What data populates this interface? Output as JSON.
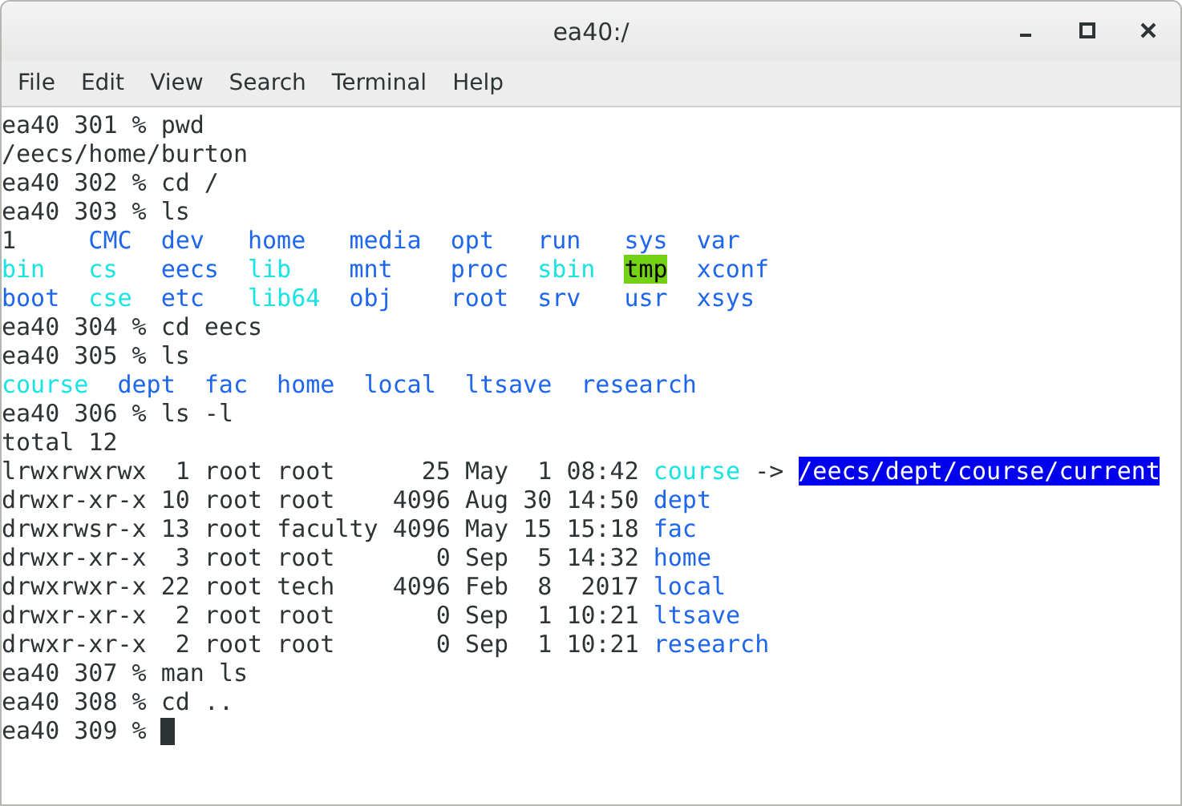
{
  "window": {
    "title": "ea40:/"
  },
  "menu": [
    "File",
    "Edit",
    "View",
    "Search",
    "Terminal",
    "Help"
  ],
  "terminal": [
    {
      "kind": "text",
      "text": "ea40 301 % pwd"
    },
    {
      "kind": "text",
      "text": "/eecs/home/burton"
    },
    {
      "kind": "text",
      "text": "ea40 302 % cd /"
    },
    {
      "kind": "text",
      "text": "ea40 303 % ls"
    },
    {
      "kind": "listing",
      "columns": [
        [
          {
            "name": "1",
            "kind": "file"
          },
          {
            "name": "bin",
            "kind": "link"
          },
          {
            "name": "boot",
            "kind": "dir"
          }
        ],
        [
          {
            "name": "CMC",
            "kind": "dir"
          },
          {
            "name": "cs",
            "kind": "link"
          },
          {
            "name": "cse",
            "kind": "link"
          }
        ],
        [
          {
            "name": "dev",
            "kind": "dir"
          },
          {
            "name": "eecs",
            "kind": "dir"
          },
          {
            "name": "etc",
            "kind": "dir"
          }
        ],
        [
          {
            "name": "home",
            "kind": "dir"
          },
          {
            "name": "lib",
            "kind": "link"
          },
          {
            "name": "lib64",
            "kind": "link"
          }
        ],
        [
          {
            "name": "media",
            "kind": "dir"
          },
          {
            "name": "mnt",
            "kind": "dir"
          },
          {
            "name": "obj",
            "kind": "dir"
          }
        ],
        [
          {
            "name": "opt",
            "kind": "dir"
          },
          {
            "name": "proc",
            "kind": "dir"
          },
          {
            "name": "root",
            "kind": "dir"
          }
        ],
        [
          {
            "name": "run",
            "kind": "dir"
          },
          {
            "name": "sbin",
            "kind": "link"
          },
          {
            "name": "srv",
            "kind": "dir"
          }
        ],
        [
          {
            "name": "sys",
            "kind": "dir"
          },
          {
            "name": "tmp",
            "kind": "sticky"
          },
          {
            "name": "usr",
            "kind": "dir"
          }
        ],
        [
          {
            "name": "var",
            "kind": "dir"
          },
          {
            "name": "xconf",
            "kind": "dir"
          },
          {
            "name": "xsys",
            "kind": "dir"
          }
        ]
      ]
    },
    {
      "kind": "text",
      "text": "ea40 304 % cd eecs"
    },
    {
      "kind": "text",
      "text": "ea40 305 % ls"
    },
    {
      "kind": "listing",
      "columns": [
        [
          {
            "name": "course",
            "kind": "link"
          }
        ],
        [
          {
            "name": "dept",
            "kind": "dir"
          }
        ],
        [
          {
            "name": "fac",
            "kind": "dir"
          }
        ],
        [
          {
            "name": "home",
            "kind": "dir"
          }
        ],
        [
          {
            "name": "local",
            "kind": "dir"
          }
        ],
        [
          {
            "name": "ltsave",
            "kind": "dir"
          }
        ],
        [
          {
            "name": "research",
            "kind": "dir"
          }
        ]
      ]
    },
    {
      "kind": "text",
      "text": "ea40 306 % ls -l"
    },
    {
      "kind": "text",
      "text": "total 12"
    },
    {
      "kind": "long",
      "meta": "lrwxrwxrwx  1 root root      25 May  1 08:42",
      "file": {
        "name": "course",
        "kind": "link"
      },
      "arrow": "->",
      "target": "/eecs/dept/course/current"
    },
    {
      "kind": "long",
      "meta": "drwxr-xr-x 10 root root    4096 Aug 30 14:50",
      "file": {
        "name": "dept",
        "kind": "dir"
      }
    },
    {
      "kind": "long",
      "meta": "drwxrwsr-x 13 root faculty 4096 May 15 15:18",
      "file": {
        "name": "fac",
        "kind": "dir"
      }
    },
    {
      "kind": "long",
      "meta": "drwxr-xr-x  3 root root       0 Sep  5 14:32",
      "file": {
        "name": "home",
        "kind": "dir"
      }
    },
    {
      "kind": "long",
      "meta": "drwxrwxr-x 22 root tech    4096 Feb  8  2017",
      "file": {
        "name": "local",
        "kind": "dir"
      }
    },
    {
      "kind": "long",
      "meta": "drwxr-xr-x  2 root root       0 Sep  1 10:21",
      "file": {
        "name": "ltsave",
        "kind": "dir"
      }
    },
    {
      "kind": "long",
      "meta": "drwxr-xr-x  2 root root       0 Sep  1 10:21",
      "file": {
        "name": "research",
        "kind": "dir"
      }
    },
    {
      "kind": "text",
      "text": "ea40 307 % man ls"
    },
    {
      "kind": "text",
      "text": "ea40 308 % cd .."
    },
    {
      "kind": "text",
      "text": "ea40 309 %",
      "cursor": true
    }
  ]
}
